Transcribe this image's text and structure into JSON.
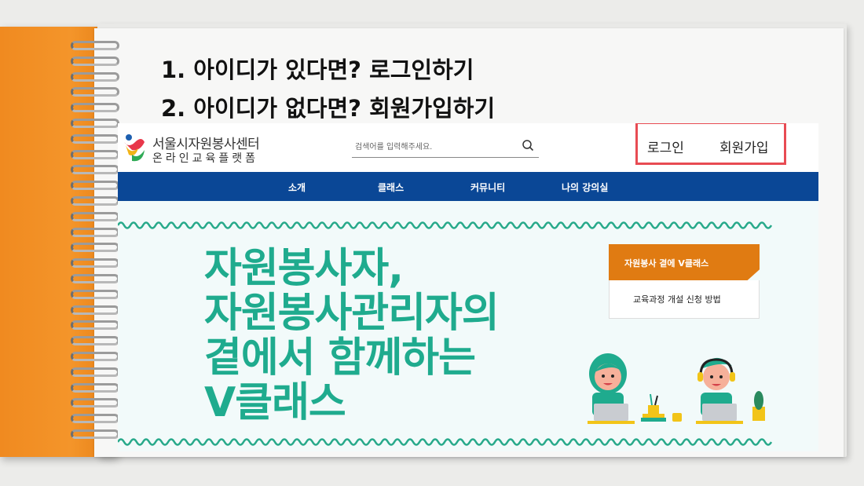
{
  "instructions": [
    "1. 아이디가 있다면?  로그인하기",
    "2. 아이디가 없다면? 회원가입하기"
  ],
  "site": {
    "logo_line1": "서울시자원봉사센터",
    "logo_line2": "온라인교육플랫폼",
    "search_placeholder": "검색어를 입력해주세요.",
    "login_label": "로그인",
    "signup_label": "회원가입",
    "nav": [
      "소개",
      "클래스",
      "커뮤니티",
      "나의 강의실"
    ],
    "hero_title_lines": [
      "자원봉사자,",
      "자원봉사관리자의",
      "곁에서 함께하는",
      "V클래스"
    ],
    "card_tab_label": "자원봉사 곁에 V클래스",
    "card_body_label": "교육과정 개설 신청 방법"
  },
  "colors": {
    "nav_bg": "#0a4796",
    "hero_title": "#1fab8e",
    "card_tab": "#e07b12",
    "highlight_box": "#e84b53",
    "cover": "#f4952a"
  }
}
